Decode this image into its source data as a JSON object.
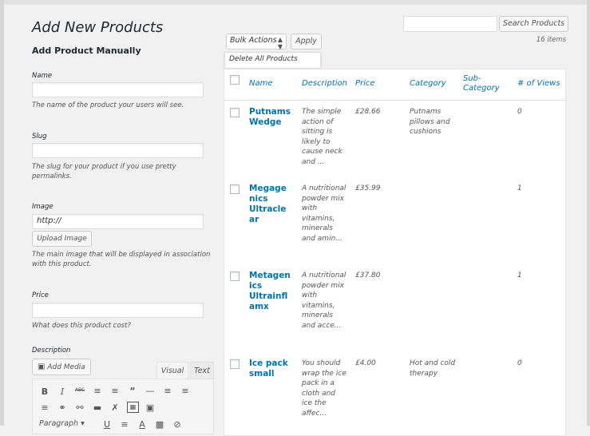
{
  "form": {
    "title": "Add New Products",
    "subtitle": "Add Product Manually",
    "name_label": "Name",
    "name_value": "",
    "name_desc": "The name of the product your users will see.",
    "slug_label": "Slug",
    "slug_value": "",
    "slug_desc": "The slug for your product if you use pretty permalinks.",
    "image_label": "Image",
    "image_value": "http://",
    "upload_button": "Upload Image",
    "image_desc": "The main image that will be displayed in association with this product.",
    "price_label": "Price",
    "price_value": "",
    "price_desc": "What does this product cost?",
    "description_label": "Description",
    "add_media_button": "Add Media",
    "tab_visual": "Visual",
    "tab_text": "Text",
    "paragraph_select": "Paragraph"
  },
  "list": {
    "search_placeholder": "",
    "search_button": "Search Products",
    "item_count": "16 items",
    "bulk_actions": "Bulk Actions",
    "apply_button": "Apply",
    "bulk_option": "Delete All Products",
    "columns": [
      "Name",
      "Description",
      "Price",
      "Category",
      "Sub-Category",
      "# of Views"
    ],
    "rows": [
      {
        "name": "Putnams Wedge",
        "description": "The simple action of sitting is likely to cause neck and ...",
        "price": "£28.66",
        "category": "Putnams pillows and cushions",
        "subcategory": "",
        "views": "0"
      },
      {
        "name": "Megagenics Ultraclear",
        "description": "A nutritional powder mix with vitamins, minerals and amin...",
        "price": "£35.99",
        "category": "",
        "subcategory": "",
        "views": "1"
      },
      {
        "name": "Metagenics Ultrainflamx",
        "description": "A nutritional powder mix with vitamins, minerals and acce...",
        "price": "£37.80",
        "category": "",
        "subcategory": "",
        "views": "1"
      },
      {
        "name": "Ice pack small",
        "description": "You should wrap the ice pack in a cloth and ice the affec...",
        "price": "£4.00",
        "category": "Hot and cold therapy",
        "subcategory": "",
        "views": "0"
      }
    ]
  },
  "accent_color": "#0073aa"
}
